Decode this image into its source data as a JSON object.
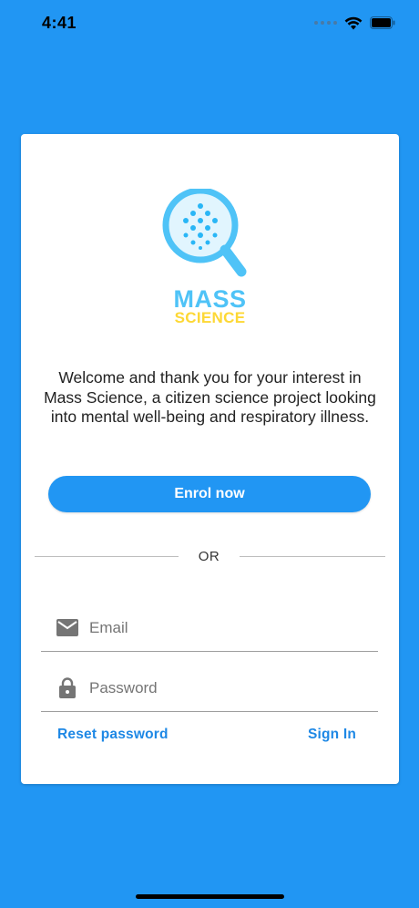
{
  "status_bar": {
    "time": "4:41"
  },
  "logo": {
    "line1": "MASS",
    "line2": "SCIENCE",
    "icon": "magnifier-logo-icon"
  },
  "welcome_text": "Welcome and thank you for your interest in Mass Science, a citizen science project looking into mental well-being  and respiratory illness.",
  "enrol_button": {
    "label": "Enrol now"
  },
  "divider": {
    "label": "OR"
  },
  "email_field": {
    "placeholder": "Email",
    "value": "",
    "icon": "mail-icon"
  },
  "password_field": {
    "placeholder": "Password",
    "value": "",
    "icon": "lock-icon"
  },
  "links": {
    "reset_password": "Reset password",
    "sign_in": "Sign In"
  },
  "colors": {
    "background": "#2196F3",
    "accent": "#2196F3",
    "link": "#1E88E5",
    "logo_blue": "#4FC3F7",
    "logo_yellow": "#FDD835"
  }
}
